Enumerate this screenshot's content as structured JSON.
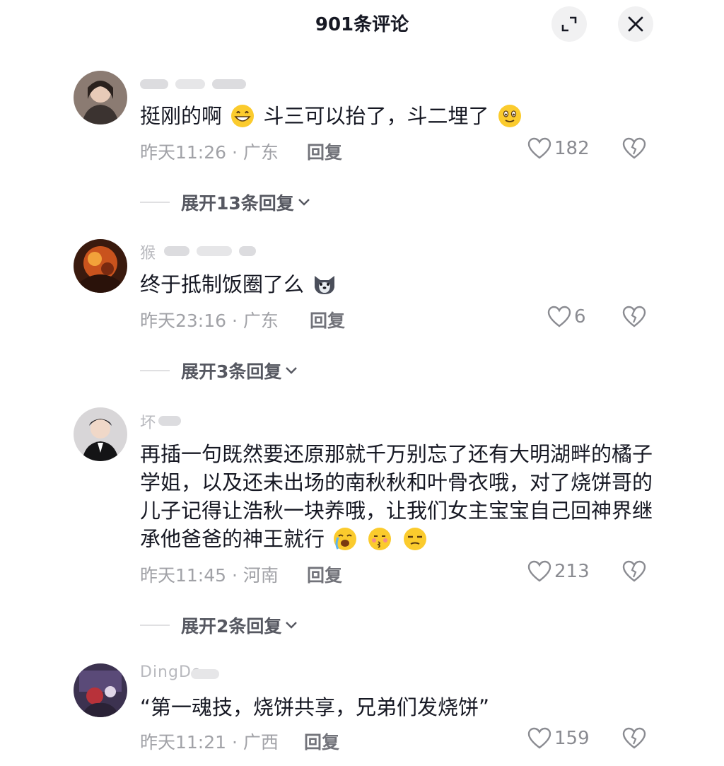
{
  "header": {
    "title": "901条评论",
    "expand_icon": "expand-icon",
    "close_icon": "close-icon"
  },
  "comments": [
    {
      "username_partial": "",
      "avatar_color": "#6a5a52",
      "text_parts": [
        "挺刚的啊",
        "斗三可以抬了，斗二埋了"
      ],
      "emojis": [
        "grinning-face-emoji",
        "smiling-face-emoji"
      ],
      "time_location": "昨天11:26 · 广东",
      "reply_label": "回复",
      "likes": "182",
      "expand_label": "展开13条回复"
    },
    {
      "username_partial": "猴",
      "avatar_color": "#b0491e",
      "text_parts": [
        "终于抵制饭圈了么"
      ],
      "emojis": [
        "husky-dog-emoji"
      ],
      "time_location": "昨天23:16 · 广东",
      "reply_label": "回复",
      "likes": "6",
      "expand_label": "展开3条回复"
    },
    {
      "username_partial": "坏",
      "avatar_color": "#3a3a40",
      "text_parts": [
        "再插一句既然要还原那就千万别忘了还有大明湖畔的橘子学姐，以及还未出场的南秋秋和叶骨衣哦，对了烧饼哥的儿子记得让浩秋一块养哦，让我们女主宝宝自己回神界继承他爸爸的神王就行"
      ],
      "emojis": [
        "crying-face-emoji",
        "kiss-face-emoji",
        "unamused-face-emoji"
      ],
      "time_location": "昨天11:45 · 河南",
      "reply_label": "回复",
      "likes": "213",
      "expand_label": "展开2条回复"
    },
    {
      "username_partial": "DingDo",
      "avatar_color": "#4a3a5a",
      "text_parts": [
        "“第一魂技，烧饼共享，兄弟们发烧饼”"
      ],
      "emojis": [],
      "time_location": "昨天11:21 · 广西",
      "reply_label": "回复",
      "likes": "159"
    }
  ],
  "icons": {
    "like": "heart-icon",
    "dislike": "broken-heart-icon",
    "chevron": "chevron-down-icon"
  }
}
